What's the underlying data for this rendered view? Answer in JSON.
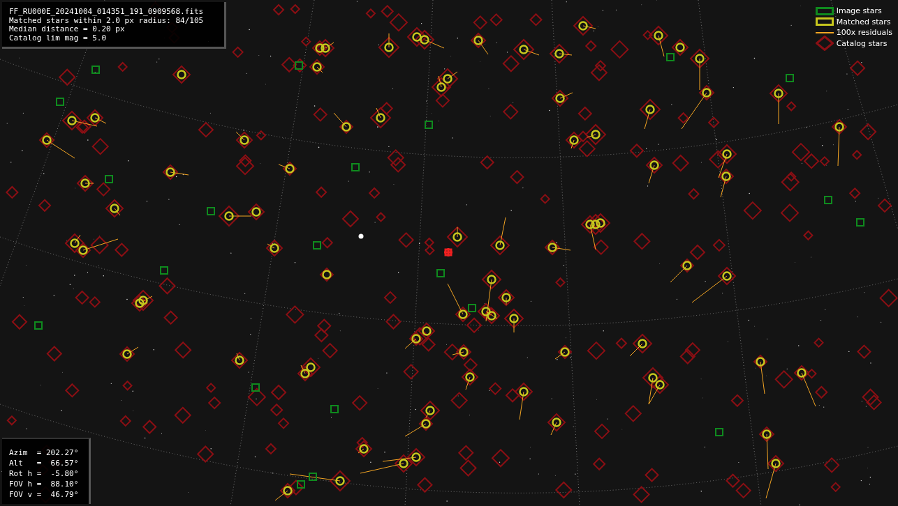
{
  "info_box": {
    "lines": [
      "FF_RU000E_20241004_014351_191_0909568.fits",
      "Matched stars within 2.0 px radius: 84/105",
      "Median distance = 0.20 px",
      "Catalog lim mag = 5.0"
    ]
  },
  "legend": {
    "items": [
      {
        "kind": "image",
        "label": "Image stars"
      },
      {
        "kind": "matched",
        "label": "Matched stars"
      },
      {
        "kind": "residual",
        "label": "100x residuals"
      },
      {
        "kind": "catalog",
        "label": "Catalog stars"
      }
    ]
  },
  "pointing_box": {
    "lines": [
      "Azim  = 202.27°",
      "Alt   =  66.57°",
      "Rot h =  -5.80°",
      "FOV h =  88.10°",
      "FOV v =  46.79°"
    ]
  }
}
